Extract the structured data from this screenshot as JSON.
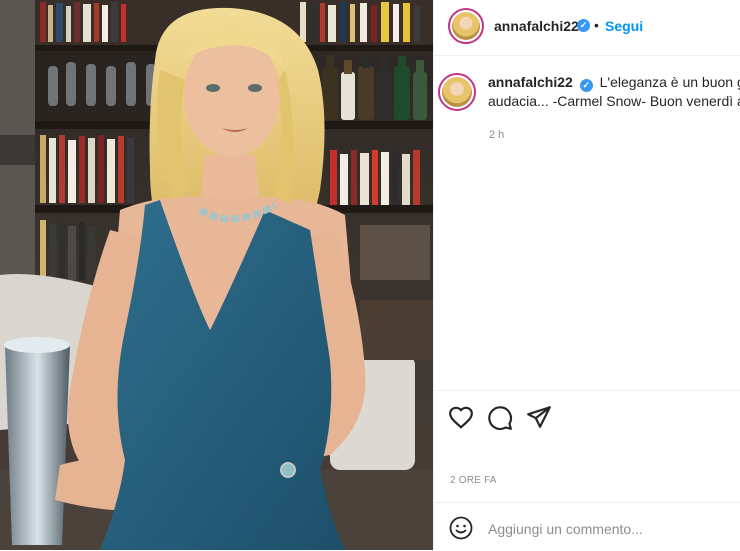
{
  "post": {
    "photo_alt": "",
    "username": "annafalchi22",
    "follow_label": "Segui",
    "separator": "•",
    "caption_text": "L'eleganza è un buon gusto plus un pizzico di",
    "caption_line2": "audacia... -Carmel Snow- Buon venerdì amici",
    "caption_time": "2 h",
    "timestamp": "2 ORE FA",
    "comment_placeholder": "Aggiungi un commento...",
    "icons": [
      "heart-icon",
      "comment-icon",
      "share-icon",
      "emoji-icon",
      "verified-badge-icon"
    ]
  }
}
